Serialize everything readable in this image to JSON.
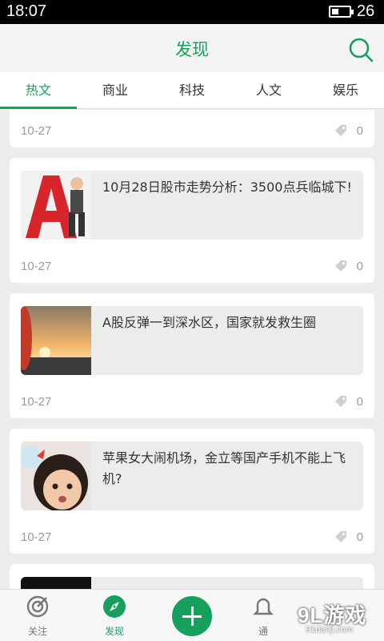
{
  "status_bar": {
    "time": "18:07",
    "battery_level": "26"
  },
  "header": {
    "title": "发现"
  },
  "tabs": [
    {
      "label": "热文",
      "active": true
    },
    {
      "label": "商业",
      "active": false
    },
    {
      "label": "科技",
      "active": false
    },
    {
      "label": "人文",
      "active": false
    },
    {
      "label": "娱乐",
      "active": false
    }
  ],
  "feed": {
    "top_partial": {
      "date": "10-27",
      "count": "0"
    },
    "cards": [
      {
        "headline": "10月28日股市走势分析：3500点兵临城下!",
        "date": "10-27",
        "count": "0",
        "thumb_icon": "stock-letter-a-thumbnail"
      },
      {
        "headline": "A股反弹一到深水区，国家就发救生圈",
        "date": "10-27",
        "count": "0",
        "thumb_icon": "sunset-sea-thumbnail"
      },
      {
        "headline": "苹果女大闹机场，金立等国产手机不能上飞机?",
        "date": "10-27",
        "count": "0",
        "thumb_icon": "child-face-thumbnail"
      }
    ]
  },
  "bottom_nav": {
    "follow_label": "关注",
    "discover_label": "发现",
    "notify_label": "通"
  },
  "watermark": {
    "logo": "9L游戏",
    "site": "91danji.com"
  },
  "colors": {
    "accent": "#17a05d",
    "background": "#ececec"
  }
}
